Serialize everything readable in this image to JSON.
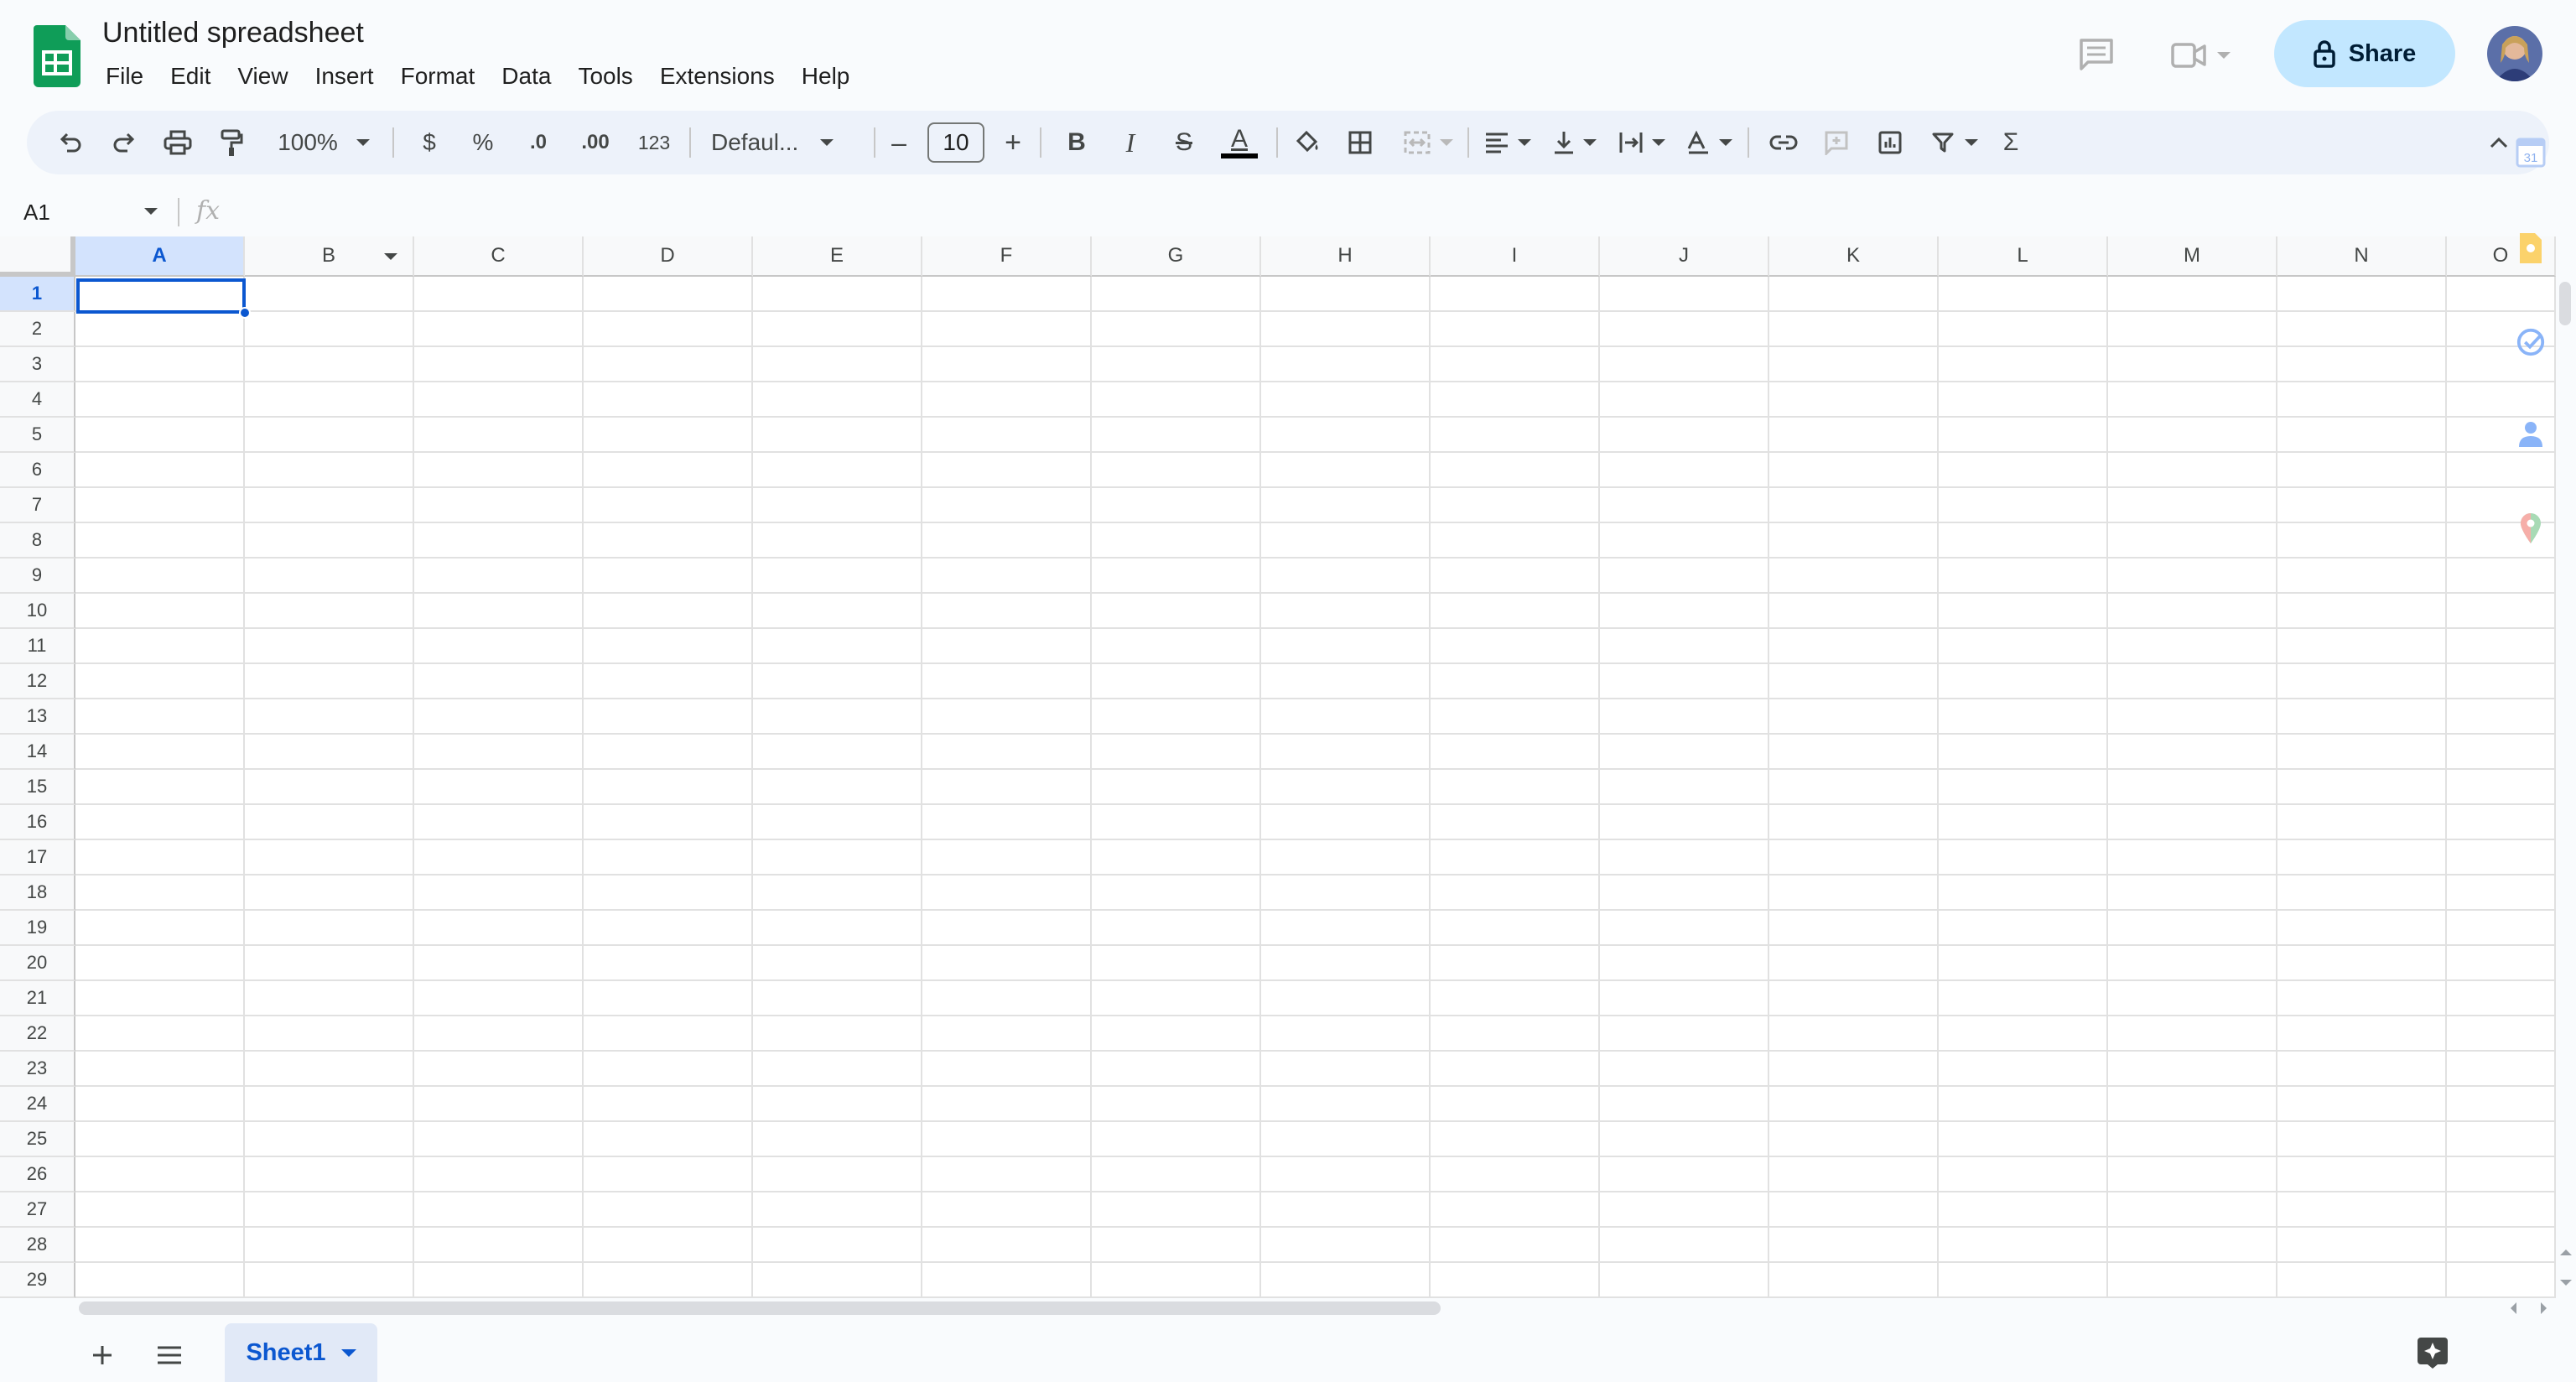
{
  "app": {
    "title": "Untitled spreadsheet",
    "brand_color": "#0f9d58"
  },
  "menu": [
    "File",
    "Edit",
    "View",
    "Insert",
    "Format",
    "Data",
    "Tools",
    "Extensions",
    "Help"
  ],
  "header": {
    "share_label": "Share",
    "icons": [
      "comment-history-icon",
      "meet-video-icon",
      "lock-icon",
      "avatar"
    ]
  },
  "toolbar": {
    "zoom": "100%",
    "currency": "$",
    "percent": "%",
    "decrease_decimal": ".0",
    "increase_decimal": ".00",
    "more_formats": "123",
    "font": "Defaul...",
    "font_size": "10",
    "font_size_minus": "–",
    "font_size_plus": "+",
    "bold": "B",
    "italic": "I",
    "strike": "S",
    "text_color": "A",
    "functions": "Σ"
  },
  "formula_bar": {
    "name_box": "A1",
    "fx": "fx",
    "value": ""
  },
  "grid": {
    "columns": [
      "A",
      "B",
      "C",
      "D",
      "E",
      "F",
      "G",
      "H",
      "I",
      "J",
      "K",
      "L",
      "M",
      "N",
      "O"
    ],
    "rows": [
      "1",
      "2",
      "3",
      "4",
      "5",
      "6",
      "7",
      "8",
      "9",
      "10",
      "11",
      "12",
      "13",
      "14",
      "15",
      "16",
      "17",
      "18",
      "19",
      "20",
      "21",
      "22",
      "23",
      "24",
      "25",
      "26",
      "27",
      "28",
      "29"
    ],
    "selected_cell": "A1",
    "selection_color": "#0b57d0"
  },
  "sheets": {
    "tabs": [
      {
        "name": "Sheet1",
        "active": true
      }
    ]
  },
  "side_panel": {
    "icons": [
      "calendar-icon",
      "keep-icon",
      "tasks-icon",
      "contacts-icon",
      "maps-icon"
    ],
    "calendar_day": "31"
  }
}
